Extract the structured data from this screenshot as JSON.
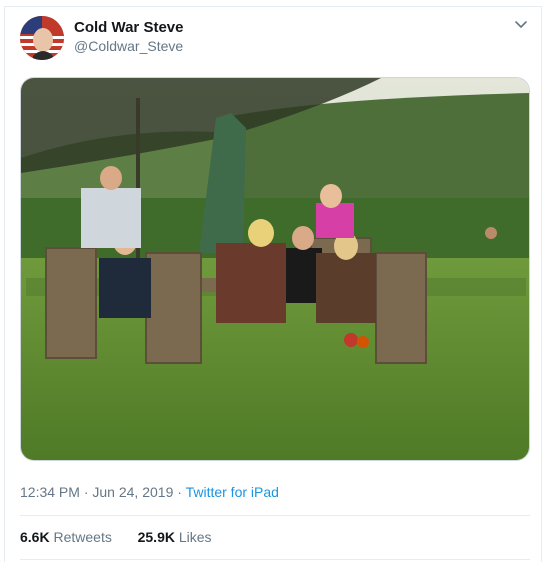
{
  "tweet": {
    "display_name": "Cold War Steve",
    "handle": "@Coldwar_Steve",
    "time": "12:34 PM",
    "date": "Jun 24, 2019",
    "separator": " · ",
    "source": "Twitter for iPad"
  },
  "stats": {
    "retweets_count": "6.6K",
    "retweets_label": "Retweets",
    "likes_count": "25.9K",
    "likes_label": "Likes"
  },
  "icons": {
    "menu": "chevron-down-icon"
  },
  "colors": {
    "link": "#1b95e0",
    "secondary_text": "#657786",
    "primary_text": "#14171a"
  }
}
